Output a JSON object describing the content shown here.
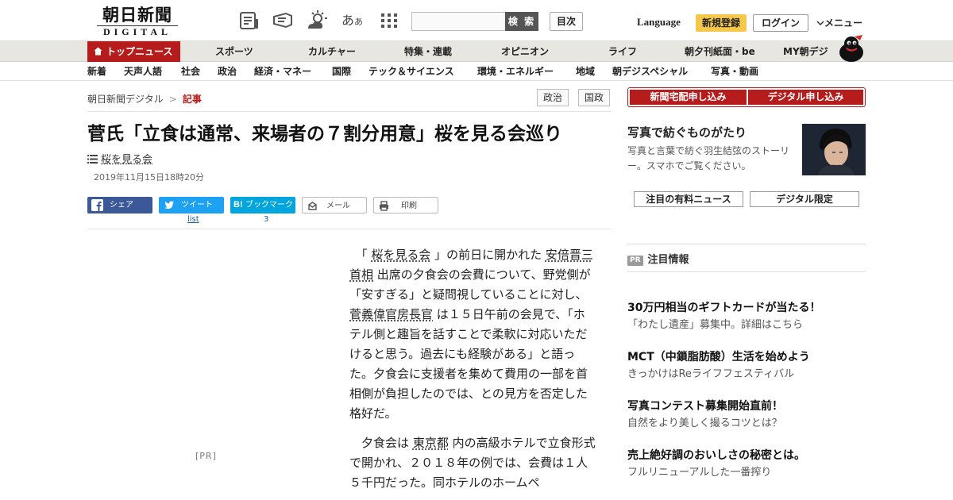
{
  "header": {
    "logo_kanji": "朝日新聞",
    "logo_latin": "DIGITAL",
    "search_button": "検 索",
    "toc_button": "目次",
    "language": "Language",
    "register": "新規登録",
    "login": "ログイン",
    "menu": "メニュー"
  },
  "category_nav": [
    "トップニュース",
    "スポーツ",
    "カルチャー",
    "特集・連載",
    "オピニオン",
    "ライフ",
    "朝夕刊紙面・be",
    "MY朝デジ"
  ],
  "sub_nav": [
    "新着",
    "天声人語",
    "社会",
    "政治",
    "経済・マネー",
    "国際",
    "テック＆サイエンス",
    "環境・エネルギー",
    "地域",
    "朝デジスペシャル",
    "写真・動画"
  ],
  "breadcrumb": {
    "home": "朝日新聞デジタル",
    "sep": ">",
    "current": "記事"
  },
  "tags": [
    "政治",
    "国政"
  ],
  "article": {
    "headline": "菅氏「立食は通常、来場者の７割分用意」桜を見る会巡り",
    "topic": "桜を見る会",
    "date": "2019年11月15日18時20分",
    "share": {
      "facebook": "シェア",
      "twitter": "ツイート",
      "twitter_count": "list",
      "hatena": "ブックマーク",
      "hatena_count": "3",
      "mail": "メール",
      "print": "印刷"
    },
    "pr_label": "[PR]",
    "p1": {
      "a": "「",
      "link1": "桜を見る会",
      "b": "」の前日に開かれた",
      "link2": "安倍晋三首相",
      "c": "出席の夕食会の会費について、野党側が「安すぎる」と疑問視していることに対し、",
      "link3": "菅義偉官房長官",
      "d": "は１５日午前の会見で、「ホテル側と趣旨を話すことで柔軟に対応いただけると思う。過去にも経験がある」と語った。夕食会に支援者を集めて費用の一部を首相側が負担したのでは、との見方を否定した格好だ。"
    },
    "p2": {
      "a": "夕食会は",
      "link1": "東京都",
      "b": "内の高級ホテルで立食形式で開かれ、２０１８年の例では、会費は１人５千円だった。同ホテルのホームペ"
    }
  },
  "sidebar": {
    "subscribe_paper": "新聞宅配申し込み",
    "subscribe_digital": "デジタル申し込み",
    "feature_title": "写真で紡ぐものがたり",
    "feature_desc": "写真と言葉で紡ぐ羽生結弦のストーリー。スマホでご覧ください。",
    "btn_news": "注目の有料ニュース",
    "btn_digital": "デジタル限定",
    "pr_badge": "PR",
    "pr_heading": "注目情報",
    "promos": [
      {
        "title": "30万円相当のギフトカードが当たる！",
        "desc": "「わたし遺産」募集中。詳細はこちら"
      },
      {
        "title": "MCT（中鎖脂肪酸）生活を始めよう",
        "desc": "きっかけはReライフフェスティバル"
      },
      {
        "title": "写真コンテスト募集開始直前！",
        "desc": "自然をより美しく撮るコツとは？"
      },
      {
        "title": "売上絶好調のおいしさの秘密とは。",
        "desc": "フルリニューアルした一番搾り"
      }
    ]
  },
  "colors": {
    "brand_red": "#b71c1c",
    "register_yellow": "#f5c84c",
    "facebook": "#3b5998",
    "twitter": "#1da1f2",
    "hatena": "#00a4de"
  },
  "icons": [
    "newspaper-icon",
    "megaphone-icon",
    "weather-icon",
    "font-size-icon",
    "grid-menu-icon",
    "home-icon",
    "list-icon",
    "facebook-icon",
    "twitter-icon",
    "hatena-icon",
    "mail-icon",
    "print-icon",
    "chevron-down-icon"
  ]
}
